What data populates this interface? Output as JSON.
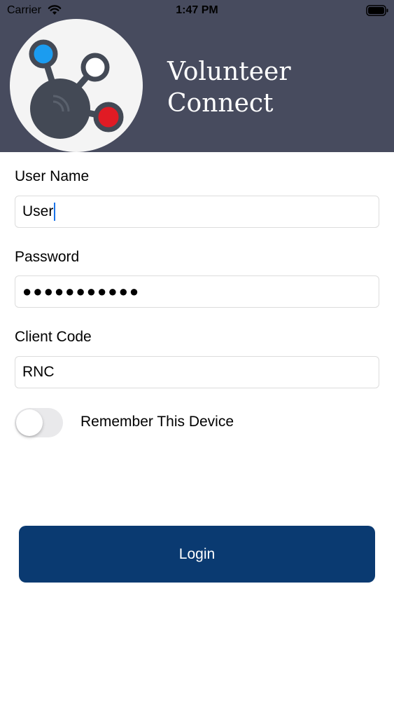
{
  "status_bar": {
    "carrier": "Carrier",
    "time": "1:47 PM",
    "icons": [
      "wifi-icon",
      "battery-icon"
    ]
  },
  "header": {
    "background_color": "#474b5e",
    "logo": "volunteer-connect-logo",
    "title_line1": "Volunteer",
    "title_line2": "Connect"
  },
  "form": {
    "username": {
      "label": "User Name",
      "value": "User"
    },
    "password": {
      "label": "Password",
      "value": "●●●●●●●●●●●"
    },
    "client_code": {
      "label": "Client Code",
      "value": "RNC"
    },
    "remember": {
      "label": "Remember This Device",
      "on": false
    }
  },
  "login_button": {
    "label": "Login",
    "color": "#0a3a71"
  }
}
